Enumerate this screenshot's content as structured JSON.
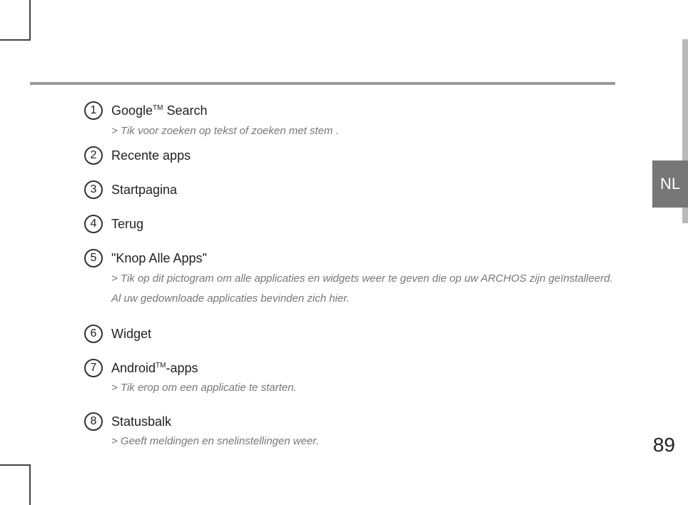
{
  "tab_label": "NL",
  "page_number": "89",
  "items": [
    {
      "num": "1",
      "title_pre": "Google",
      "title_sup": "TM",
      "title_post": " Search",
      "desc": "> Tik voor zoeken op tekst of zoeken met stem ."
    },
    {
      "num": "2",
      "title": "Recente apps"
    },
    {
      "num": "3",
      "title": "Startpagina"
    },
    {
      "num": "4",
      "title": "Terug"
    },
    {
      "num": "5",
      "title": "\"Knop Alle Apps\"",
      "desc": "> Tik op dit pictogram om alle applicaties en widgets weer te geven die op uw ARCHOS zijn geïnstalleerd.",
      "desc2": "Al uw gedownloade applicaties bevinden zich hier."
    },
    {
      "num": "6",
      "title": "Widget"
    },
    {
      "num": "7",
      "title_pre": "Android",
      "title_sup": "TM",
      "title_post": "-apps",
      "desc": "> Tik erop om een applicatie te starten."
    },
    {
      "num": "8",
      "title": "Statusbalk",
      "desc": "> Geeft meldingen en snelinstellingen weer."
    }
  ]
}
